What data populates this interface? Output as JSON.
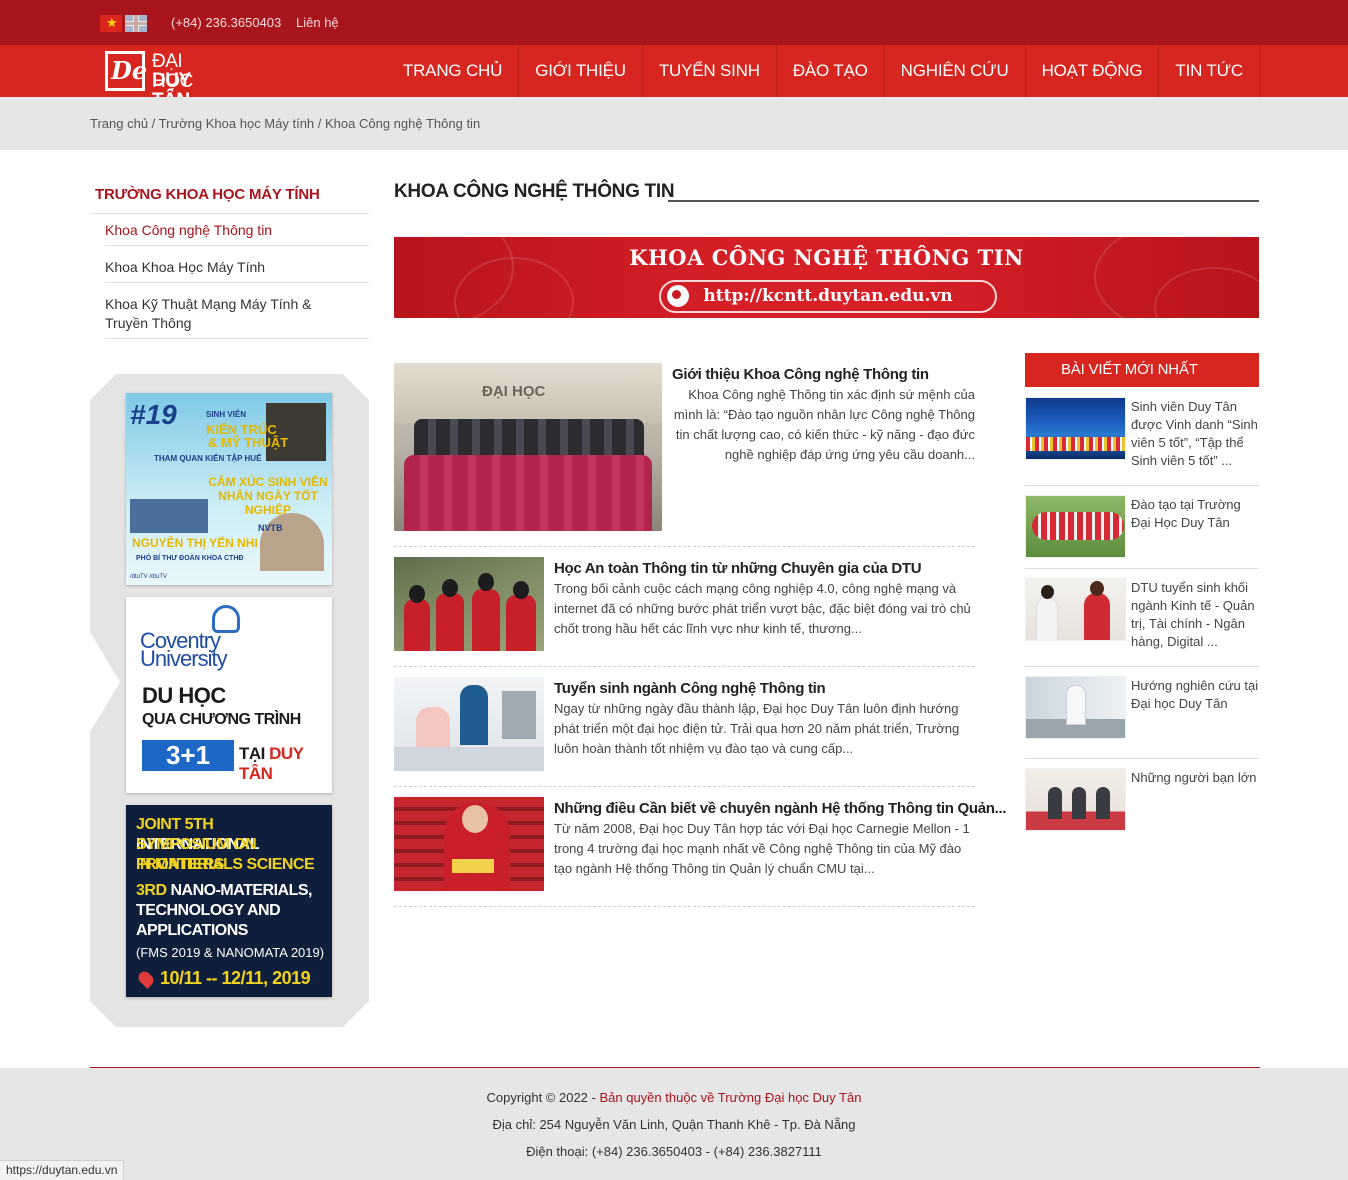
{
  "topbar": {
    "phone": "(+84) 236.3650403",
    "contact": "Liên hệ",
    "lang_vn": "Tiếng Việt",
    "lang_en": "English"
  },
  "logo": {
    "line1": "ĐẠI HỌC",
    "line2": "DUY TÂN"
  },
  "nav": {
    "items": [
      "TRANG CHỦ",
      "GIỚI THIỆU",
      "TUYỂN SINH",
      "ĐÀO TẠO",
      "NGHIÊN CỨU",
      "HOẠT ĐỘNG",
      "TIN TỨC"
    ]
  },
  "breadcrumb": {
    "home": "Trang chủ",
    "sep": " / ",
    "level2": "Trường Khoa học Máy tính",
    "current": "Khoa Công nghệ Thông tin"
  },
  "sidebar": {
    "title": "TRƯỜNG KHOA HỌC MÁY TÍNH",
    "items": [
      {
        "label": "Khoa Công nghệ Thông tin",
        "active": true
      },
      {
        "label": "Khoa Khoa Học Máy Tính",
        "active": false
      },
      {
        "label": "Khoa Kỹ Thuật Mạng Máy Tính & Truyền Thông",
        "active": false
      }
    ]
  },
  "ads": {
    "ad1": {
      "number": "#19",
      "line1": "SINH VIÊN",
      "line2": "KIẾN TRÚC",
      "line3": "& MỸ THUẬT",
      "sub": "THAM QUAN KIẾN TẬP HUẾ",
      "cx1": "CẢM XÚC SINH VIÊN",
      "cx2": "NHÂN NGÀY TỐT NGHIỆP",
      "n1": "NVTB",
      "n2": "NGUYỄN THỊ YẾN NHI",
      "n3": "PHÓ BÍ THƯ ĐOÀN KHOA CTHĐ",
      "foot": "/dtuTV   /dtuTV"
    },
    "ad2": {
      "c1": "Coventry",
      "c2": "University",
      "d1": "DU HỌC",
      "d2": "QUA CHƯƠNG TRÌNH",
      "prog": "3+1",
      "tai": "TẠI ",
      "dt": "DUY TÂN"
    },
    "ad3": {
      "l1a": "JOINT 5TH ",
      "l1b": "INTERNATIONAL",
      "l2": "SYMPOSIUM ON FRONTIERS",
      "l3": "IN MATERIALS SCIENCE",
      "l4a": "3RD ",
      "l4b": "NANO-MATERIALS,",
      "l5": "TECHNOLOGY AND",
      "l6": "APPLICATIONS",
      "l7": "(FMS 2019 & NANOMATA 2019)",
      "dates": "10/11 -- 12/11, 2019"
    }
  },
  "main": {
    "title": "KHOA CÔNG NGHỆ THÔNG TIN",
    "hero_title": "KHOA CÔNG NGHỆ THÔNG TIN",
    "hero_url": "http://kcntt.duytan.edu.vn",
    "articles": [
      {
        "title": "Giới thiệu Khoa Công nghệ Thông tin",
        "excerpt": "Khoa Công nghệ Thông tin xác định sứ mệnh của mình là: “Đào tạo nguồn nhân lực Công nghệ Thông tin chất lượng cao, có kiến thức - kỹ năng - đạo đức nghề nghiệp đáp ứng ứng yêu cầu doanh..."
      },
      {
        "title": "Học An toàn Thông tin từ những Chuyên gia của DTU",
        "excerpt": "Trong bối cảnh cuộc cách mạng công nghiệp 4.0, công nghệ mạng và internet đã có những bước phát triển vượt bậc, đặc biệt đóng vai trò chủ chốt trong hầu hết các lĩnh vực như kinh tế, thương..."
      },
      {
        "title": "Tuyển sinh ngành Công nghệ Thông tin",
        "excerpt": "Ngay từ những ngày đầu thành lập, Đại học Duy Tân luôn định hướng phát triển một đại học điện tử. Trải qua hơn 20 năm phát triển, Trường luôn hoàn thành tốt nhiệm vụ đào tạo và cung cấp..."
      },
      {
        "title": "Những điều Cần biết về chuyên ngành Hệ thống Thông tin Quản...",
        "excerpt": "Từ năm 2008, Đại học Duy Tân hợp tác với Đại học Carnegie Mellon - 1 trong 4 trường đại học mạnh nhất về Công nghệ Thông tin của Mỹ đào tạo ngành Hệ thống Thông tin Quản lý chuẩn CMU tại..."
      }
    ]
  },
  "latest": {
    "heading": "BÀI VIẾT MỚI NHẤT",
    "items": [
      "Sinh viên Duy Tân được Vinh danh “Sinh viên 5 tốt”, “Tập thể Sinh viên 5 tốt” ...",
      "Đào tạo tại Trường Đại Học Duy Tân",
      "DTU tuyển sinh khối ngành Kinh tế - Quản trị, Tài chính - Ngân hàng, Digital ...",
      "Hướng nghiên cứu tại Đại học Duy Tân",
      "Những người bạn lớn"
    ]
  },
  "footer": {
    "copyright_prefix": "Copyright © 2022 - ",
    "copyright_owner": "Bản quyền thuộc về Trường Đại học Duy Tân",
    "address": "Địa chỉ: 254 Nguyễn Văn Linh, Quận Thanh Khê - Tp. Đà Nẵng",
    "phone": "Điện thoại: (+84) 236.3650403 - (+84) 236.3827111"
  },
  "status_url": "https://duytan.edu.vn",
  "colors": {
    "topbar": "#a8151c",
    "nav": "#d6261f",
    "accent": "#a8151c",
    "band": "#e6e6e6"
  }
}
